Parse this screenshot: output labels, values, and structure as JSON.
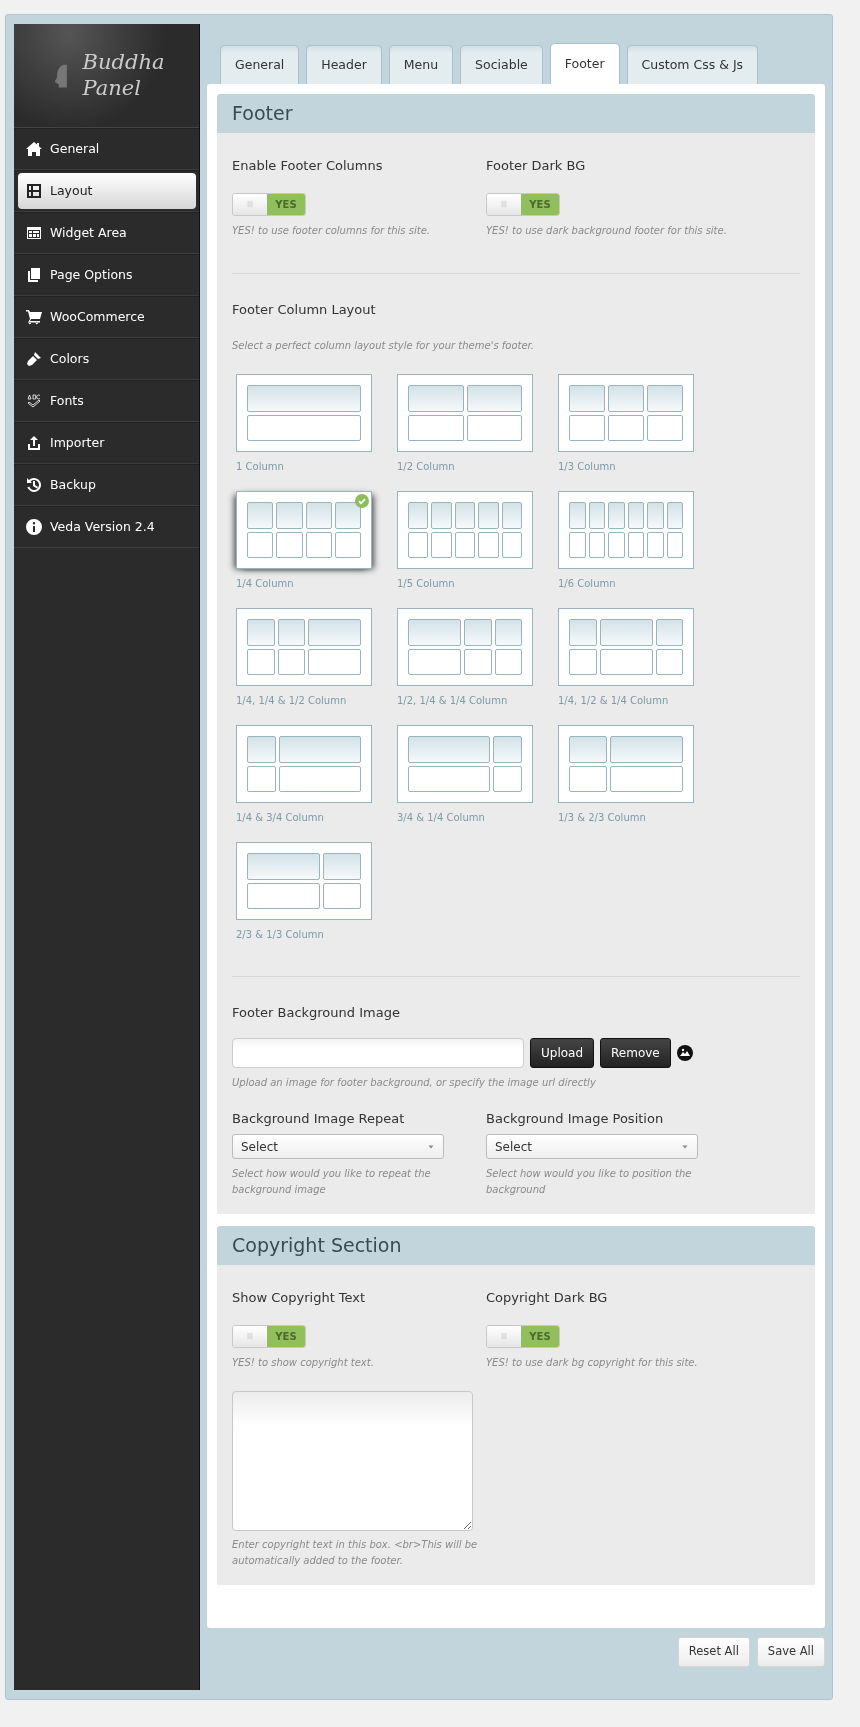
{
  "sidebar": {
    "logo": {
      "line1": "Buddha",
      "line2": "Panel"
    },
    "items": [
      {
        "label": "General",
        "selected": false
      },
      {
        "label": "Layout",
        "selected": true
      },
      {
        "label": "Widget Area",
        "selected": false
      },
      {
        "label": "Page Options",
        "selected": false
      },
      {
        "label": "WooCommerce",
        "selected": false
      },
      {
        "label": "Colors",
        "selected": false
      },
      {
        "label": "Fonts",
        "selected": false
      },
      {
        "label": "Importer",
        "selected": false
      },
      {
        "label": "Backup",
        "selected": false
      },
      {
        "label": "Veda Version 2.4",
        "selected": false
      }
    ]
  },
  "tabs": [
    {
      "label": "General",
      "selected": false
    },
    {
      "label": "Header",
      "selected": false
    },
    {
      "label": "Menu",
      "selected": false
    },
    {
      "label": "Sociable",
      "selected": false
    },
    {
      "label": "Footer",
      "selected": true
    },
    {
      "label": "Custom Css & Js",
      "selected": false
    }
  ],
  "sections": [
    {
      "title": "Footer",
      "blocks": [
        {
          "kind": "toggles",
          "items": [
            {
              "label": "Enable Footer Columns",
              "on": true,
              "text": "YES",
              "hint": "YES! to use footer columns for this site."
            },
            {
              "label": "Footer Dark BG",
              "on": true,
              "text": "YES",
              "hint": "YES! to use dark background footer for this site."
            }
          ]
        },
        {
          "kind": "layouts",
          "label": "Footer Column Layout",
          "hint": "Select a perfect column layout style for your theme's footer.",
          "options": [
            {
              "caption": "1 Column",
              "kind": "full",
              "selected": false
            },
            {
              "caption": "1/2 Column",
              "kind": "halves",
              "selected": false
            },
            {
              "caption": "1/3 Column",
              "kind": "thirds",
              "selected": false
            },
            {
              "caption": "1/4 Column",
              "kind": "quarters",
              "selected": true
            },
            {
              "caption": "1/5 Column",
              "kind": "fifths",
              "selected": false
            },
            {
              "caption": "1/6 Column",
              "kind": "sixths",
              "selected": false
            },
            {
              "caption": "1/4, 1/4 & 1/2 Column",
              "kind": "quarterquarterhalf",
              "selected": false
            },
            {
              "caption": "1/2, 1/4 & 1/4 Column",
              "kind": "halfquarterquarter",
              "selected": false
            },
            {
              "caption": "1/4, 1/2 & 1/4 Column",
              "kind": "quarterhalfquarter",
              "selected": false
            },
            {
              "caption": "1/4 & 3/4 Column",
              "kind": "quarterthreequarters",
              "selected": false
            },
            {
              "caption": "3/4 & 1/4 Column",
              "kind": "threequartersquarter",
              "selected": false
            },
            {
              "caption": "1/3 & 2/3 Column",
              "kind": "thirdtwothirds",
              "selected": false
            },
            {
              "caption": "2/3 & 1/3 Column",
              "kind": "twothirdsthird",
              "selected": false
            }
          ]
        },
        {
          "kind": "upload",
          "label": "Footer Background Image",
          "buttons": [
            "Upload",
            "Remove"
          ],
          "hint": "Upload an image for footer background, or specify the image url directly"
        },
        {
          "kind": "selects",
          "items": [
            {
              "label": "Background Image Repeat",
              "value": "Select",
              "hint": "Select how would you like to repeat the background image"
            },
            {
              "label": "Background Image Position",
              "value": "Select",
              "hint": "Select how would you like to position the background"
            }
          ]
        }
      ]
    },
    {
      "title": "Copyright Section",
      "blocks": [
        {
          "kind": "toggles",
          "items": [
            {
              "label": "Show Copyright Text",
              "on": true,
              "text": "YES",
              "hint": "YES! to show copyright text."
            },
            {
              "label": "Copyright Dark BG",
              "on": true,
              "text": "YES",
              "hint": "YES! to use dark bg copyright for this site."
            }
          ]
        },
        {
          "kind": "textarea",
          "hint": "Enter copyright text in this box. <br>This will be automatically added to the footer."
        }
      ]
    }
  ],
  "actions": [
    "Reset All",
    "Save All"
  ]
}
